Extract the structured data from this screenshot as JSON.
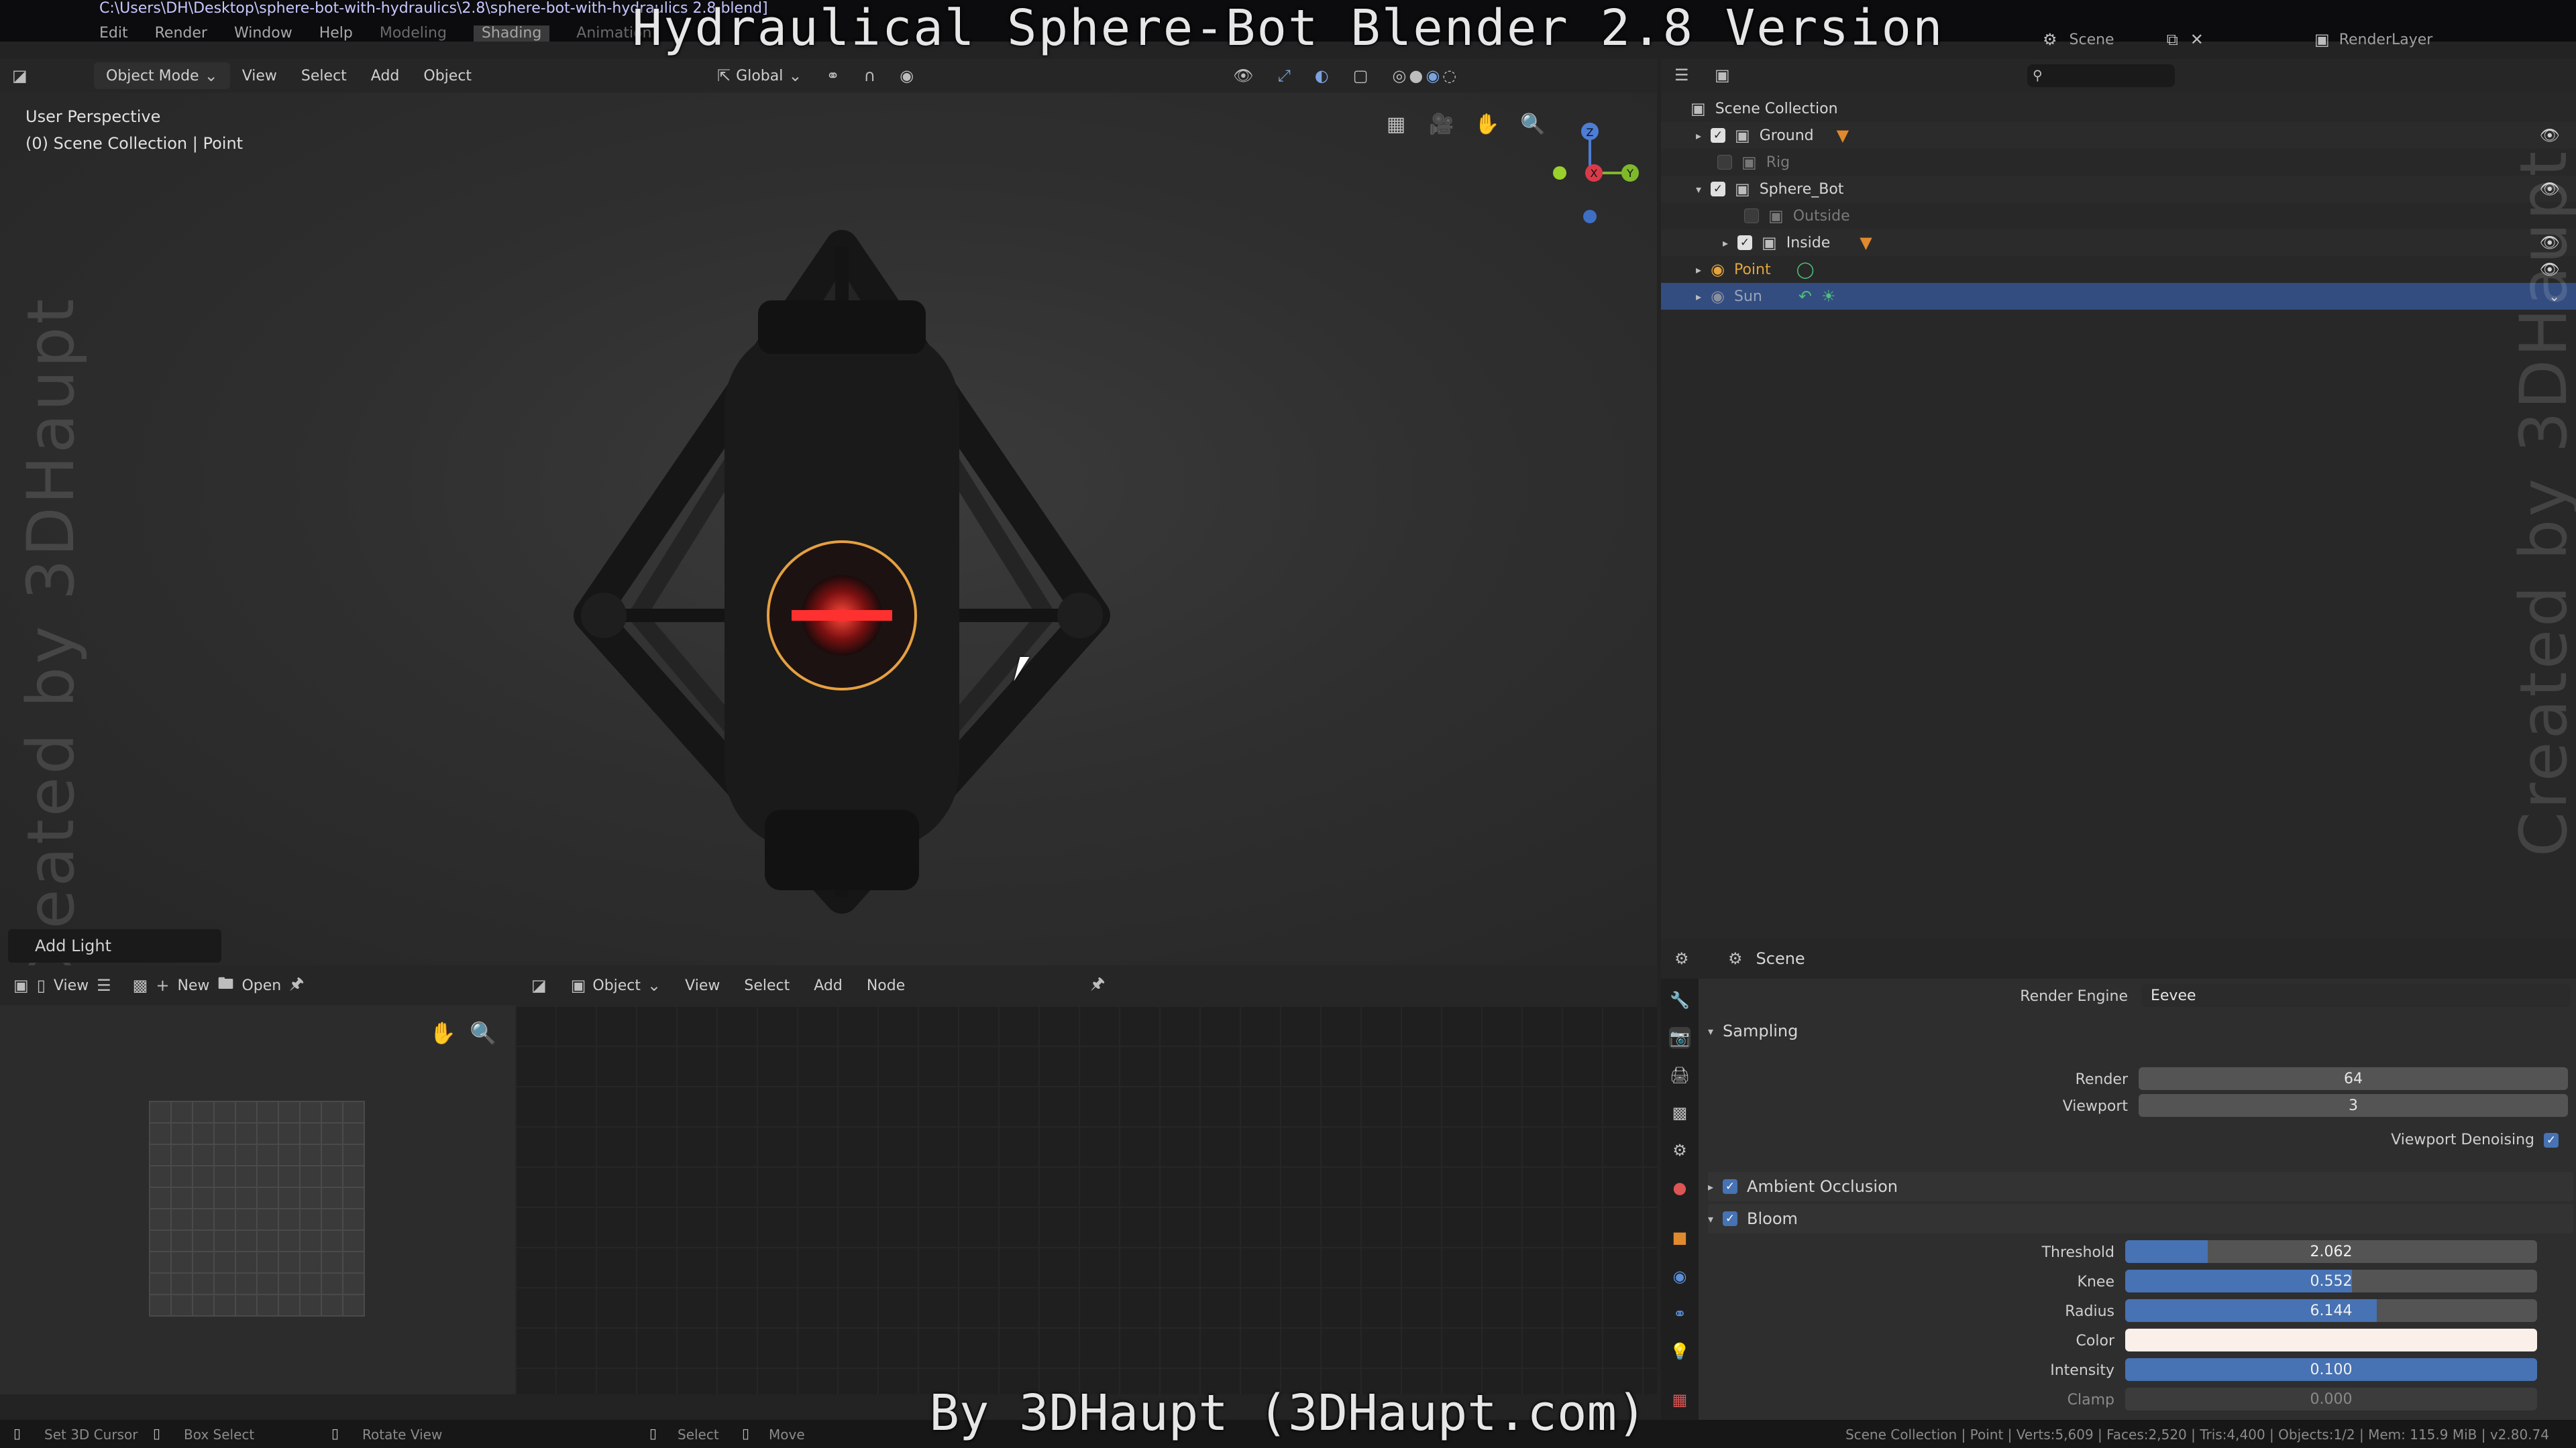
{
  "overlay": {
    "title": "Hydraulical Sphere-Bot Blender 2.8 Version",
    "credit": "By 3DHaupt (3DHaupt.com)",
    "watermark": "Created by 3DHaupt"
  },
  "topbar": {
    "filepath": "C:\\Users\\DH\\Desktop\\sphere-bot-with-hydraulics\\2.8\\sphere-bot-with-hydraulics 2.8.blend]",
    "menus": [
      "Edit",
      "Render",
      "Window",
      "Help"
    ],
    "workspaces": [
      "Modeling",
      "Shading",
      "Animation"
    ],
    "active_workspace": "Shading",
    "scene": "Scene",
    "render_layer": "RenderLayer"
  },
  "viewport": {
    "mode": "Object Mode",
    "menus": [
      "View",
      "Select",
      "Add",
      "Object"
    ],
    "orientation": "Global",
    "info_line1": "User Perspective",
    "info_line2": "(0) Scene Collection | Point",
    "last_op": "Add Light",
    "gizmo_axes": [
      "Z",
      "X",
      "Y"
    ]
  },
  "image_editor": {
    "view": "View",
    "new_label": "New",
    "open_label": "Open"
  },
  "node_editor": {
    "object": "Object",
    "menus": [
      "View",
      "Select",
      "Add",
      "Node"
    ]
  },
  "outliner": {
    "root": "Scene Collection",
    "items": [
      {
        "label": "Ground",
        "checked": true
      },
      {
        "label": "Rig",
        "checked": false
      },
      {
        "label": "Sphere_Bot",
        "checked": true
      },
      {
        "label": "Outside",
        "checked": false
      },
      {
        "label": "Inside",
        "checked": true
      },
      {
        "label": "Point"
      },
      {
        "label": "Sun"
      }
    ]
  },
  "properties": {
    "context": "Scene",
    "render_engine_label": "Render Engine",
    "render_engine": "Eevee",
    "sampling_label": "Sampling",
    "render_label": "Render",
    "render_value": "64",
    "viewport_label": "Viewport",
    "viewport_value": "3",
    "denoise_label": "Viewport Denoising",
    "ao_label": "Ambient Occlusion",
    "bloom_label": "Bloom",
    "threshold_label": "Threshold",
    "threshold": "2.062",
    "threshold_fill": 0.2,
    "knee_label": "Knee",
    "knee": "0.552",
    "knee_fill": 0.55,
    "radius_label": "Radius",
    "radius": "6.144",
    "radius_fill": 0.61,
    "color_label": "Color",
    "intensity_label": "Intensity",
    "intensity": "0.100",
    "intensity_fill": 1.0,
    "clamp_label": "Clamp",
    "clamp": "0.000"
  },
  "statusbar": {
    "items": [
      "Set 3D Cursor",
      "Box Select",
      "Rotate View",
      "Select",
      "Move"
    ],
    "stats": "Scene Collection | Point | Verts:5,609 | Faces:2,520 | Tris:4,400 | Objects:1/2 | Mem: 115.9 MiB | v2.80.74"
  },
  "colors": {
    "accent": "#4772b3",
    "selection": "#334d80",
    "light_yellow": "#e3a33f",
    "robot_red": "#ff2a2a"
  }
}
